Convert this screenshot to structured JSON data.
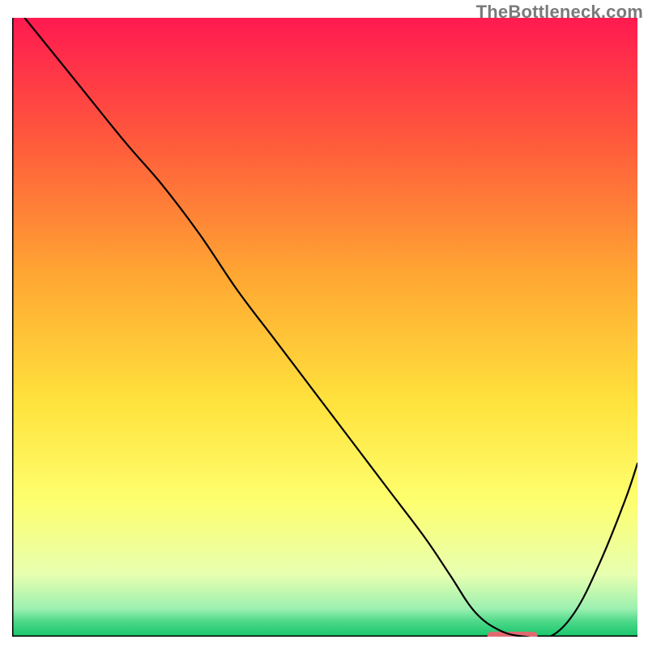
{
  "watermark": "TheBottleneck.com",
  "chart_data": {
    "type": "line",
    "title": "",
    "xlabel": "",
    "ylabel": "",
    "xlim": [
      0,
      100
    ],
    "ylim": [
      0,
      100
    ],
    "grid": false,
    "legend": false,
    "background_gradient": {
      "stops": [
        {
          "offset": 0.0,
          "color": "#ff1a50"
        },
        {
          "offset": 0.2,
          "color": "#ff5a3c"
        },
        {
          "offset": 0.42,
          "color": "#ffa832"
        },
        {
          "offset": 0.62,
          "color": "#ffe23c"
        },
        {
          "offset": 0.78,
          "color": "#feff6e"
        },
        {
          "offset": 0.9,
          "color": "#e7ffb0"
        },
        {
          "offset": 0.955,
          "color": "#9cf0b0"
        },
        {
          "offset": 0.975,
          "color": "#4fd98a"
        },
        {
          "offset": 1.0,
          "color": "#16c66a"
        }
      ]
    },
    "series": [
      {
        "name": "bottleneck-curve",
        "color": "#000000",
        "width": 2.2,
        "x": [
          2,
          10,
          18,
          24,
          30,
          36,
          42,
          48,
          54,
          60,
          66,
          70,
          74,
          78,
          82,
          86,
          90,
          94,
          98,
          100
        ],
        "y": [
          100,
          90,
          80,
          73,
          65,
          56,
          48,
          40,
          32,
          24,
          16,
          10,
          4,
          1,
          0,
          0,
          4,
          12,
          22,
          28
        ]
      }
    ],
    "marker": {
      "name": "target-pill",
      "shape": "pill",
      "color": "#e06a72",
      "x": 80,
      "y": 0.2,
      "width_pct": 8,
      "height_pct": 1.2
    },
    "axes": {
      "left": {
        "visible": true,
        "color": "#000",
        "width": 3
      },
      "bottom": {
        "visible": true,
        "color": "#000",
        "width": 3
      }
    }
  }
}
